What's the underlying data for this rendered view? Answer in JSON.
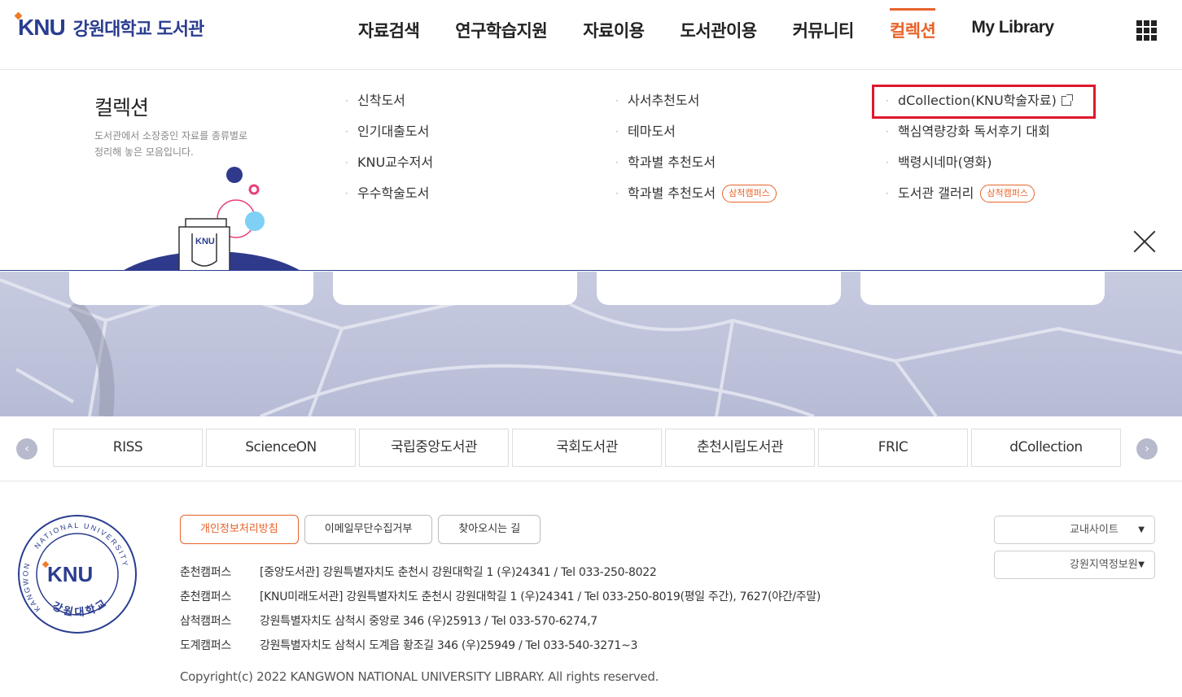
{
  "header": {
    "logo_mark": "KNU",
    "logo_text": "강원대학교 도서관",
    "nav": [
      "자료검색",
      "연구학습지원",
      "자료이용",
      "도서관이용",
      "커뮤니티",
      "컬렉션",
      "My Library"
    ],
    "active_nav": "컬렉션"
  },
  "mega": {
    "title": "컬렉션",
    "desc_line1": "도서관에서 소장중인 자료를 종류별로",
    "desc_line2": "정리해 놓은 모음입니다.",
    "illu_label": "KNU",
    "col1": [
      "신착도서",
      "인기대출도서",
      "KNU교수저서",
      "우수학술도서"
    ],
    "col2": [
      "사서추천도서",
      "테마도서",
      "학과별 추천도서",
      "학과별 추천도서"
    ],
    "col2_tag": "삼척캠퍼스",
    "col3": [
      "dCollection(KNU학술자료)",
      "핵심역량강화 독서후기 대회",
      "백령시네마(영화)",
      "도서관 갤러리"
    ],
    "col3_tag": "삼척캠퍼스"
  },
  "quick_links": [
    "RISS",
    "ScienceON",
    "국립중앙도서관",
    "국회도서관",
    "춘천시립도서관",
    "FRIC",
    "dCollection"
  ],
  "footer": {
    "buttons": [
      "개인정보처리방침",
      "이메일무단수집거부",
      "찾아오시는 길"
    ],
    "addresses": [
      {
        "campus": "춘천캠퍼스",
        "text": "[중앙도서관] 강원특별자치도 춘천시 강원대학길 1 (우)24341 / Tel 033-250-8022"
      },
      {
        "campus": "춘천캠퍼스",
        "text": "[KNU미래도서관] 강원특별자치도 춘천시 강원대학길 1 (우)24341 / Tel 033-250-8019(평일 주간), 7627(야간/주말)"
      },
      {
        "campus": "삼척캠퍼스",
        "text": "강원특별자치도 삼척시 중앙로 346 (우)25913 / Tel 033-570-6274,7"
      },
      {
        "campus": "도계캠퍼스",
        "text": "강원특별자치도 삼척시 도계읍 황조길 346 (우)25949 / Tel 033-540-3271~3"
      }
    ],
    "copyright": "Copyright(c) 2022 KANGWON NATIONAL UNIVERSITY LIBRARY. All rights reserved.",
    "select1": "교내사이트",
    "select2": "강원지역정보원",
    "seal_top": "NATIONAL UNIVERSITY",
    "seal_left": "KANGWON",
    "seal_bottom": "강원대학교",
    "seal_mark": "KNU"
  },
  "colors": {
    "accent": "#e8632b",
    "brand": "#2a3d8f",
    "highlight": "#e0182d"
  }
}
